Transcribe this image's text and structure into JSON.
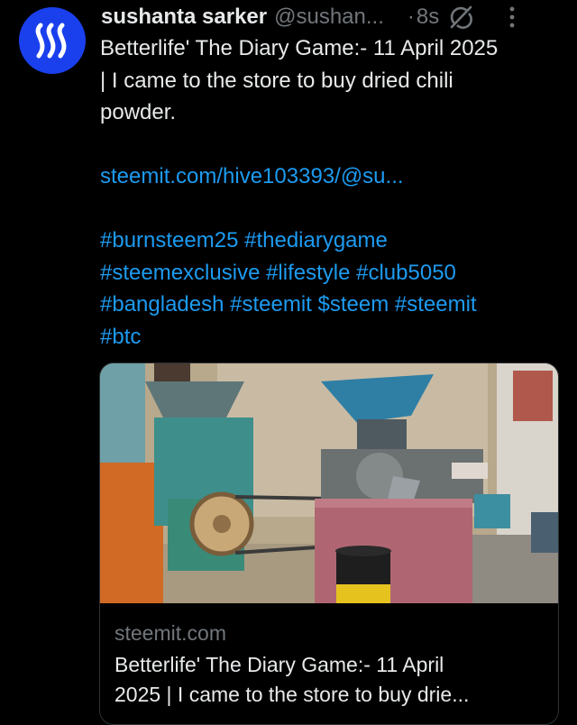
{
  "tweet": {
    "author_name": "sushanta sarker",
    "handle": "@sushan...",
    "separator": "·",
    "time": "8s",
    "text_lines": [
      "Betterlife' The Diary Game:- 11 April 2025",
      "| I came to the store to buy dried chili",
      "powder."
    ],
    "link": "steemit.com/hive103393/@su...",
    "hashtag_lines": [
      "#burnsteem25 #thediarygame",
      "#steemexclusive #lifestyle #club5050",
      "#bangladesh #steemit $steem #steemit",
      "#btc"
    ]
  },
  "card": {
    "domain": "steemit.com",
    "title_lines": [
      "Betterlife' The Diary Game:- 11 April",
      "2025 | I came to the store to buy drie..."
    ]
  },
  "icons": {
    "avatar": "steem-logo-icon",
    "grok": "grok-icon",
    "more": "more-vertical-icon"
  },
  "colors": {
    "background": "#000000",
    "text": "#e7e9ea",
    "secondary": "#71767b",
    "link": "#1d9bf0",
    "avatar_bg": "#1a40ee"
  }
}
